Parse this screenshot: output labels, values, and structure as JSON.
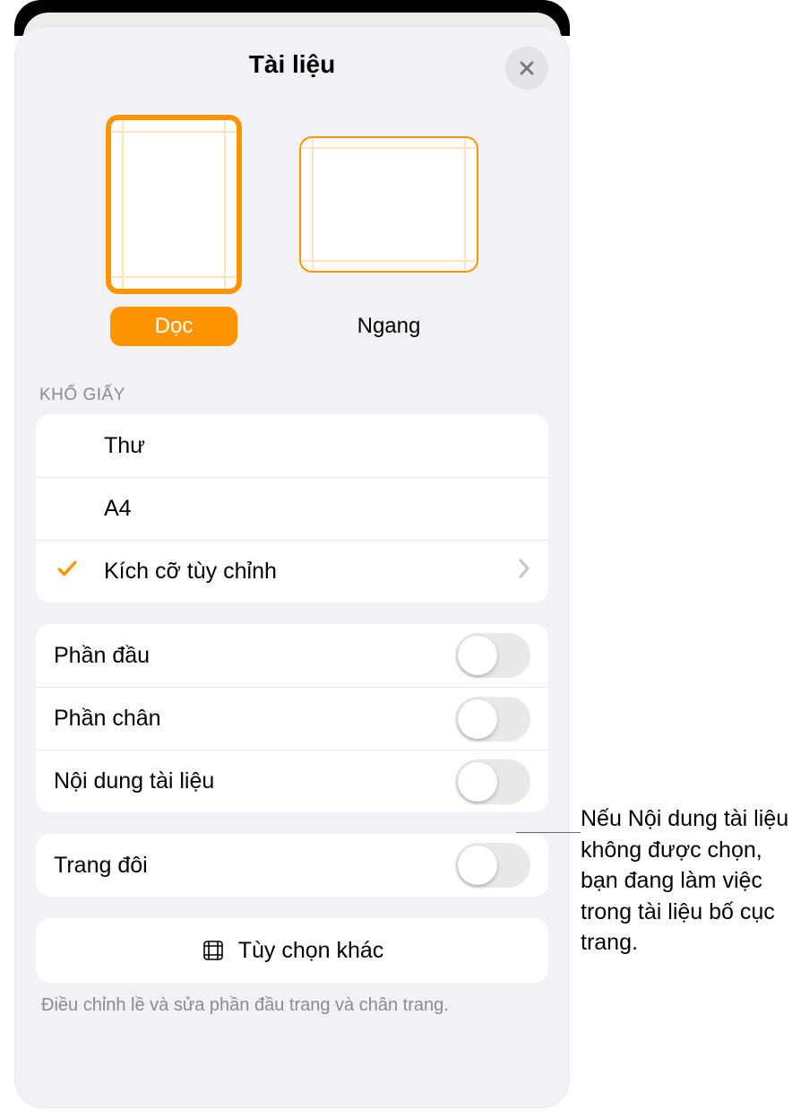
{
  "header": {
    "title": "Tài liệu",
    "close_name": "close-button"
  },
  "orientation": {
    "portrait_label": "Dọc",
    "landscape_label": "Ngang",
    "selected": "portrait"
  },
  "paper_size": {
    "section_label": "KHỔ GIẤY",
    "options": [
      {
        "label": "Thư",
        "selected": false,
        "chevron": false
      },
      {
        "label": "A4",
        "selected": false,
        "chevron": false
      },
      {
        "label": "Kích cỡ tùy chỉnh",
        "selected": true,
        "chevron": true
      }
    ]
  },
  "toggles": {
    "header_label": "Phần đầu",
    "footer_label": "Phần chân",
    "body_label": "Nội dung tài liệu",
    "facing_label": "Trang đôi",
    "header_on": false,
    "footer_on": false,
    "body_on": false,
    "facing_on": false
  },
  "more_options": {
    "label": "Tùy chọn khác"
  },
  "footer_note": "Điều chỉnh lề và sửa phần đầu trang và chân trang.",
  "callout": "Nếu Nội dung tài liệu không được chọn, bạn đang làm việc trong tài liệu bố cục trang."
}
